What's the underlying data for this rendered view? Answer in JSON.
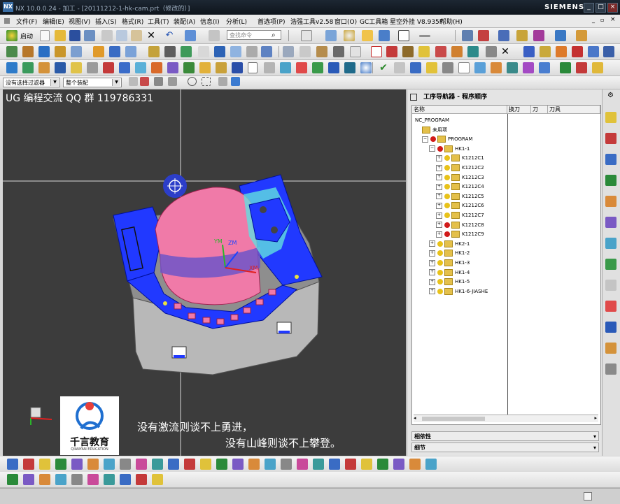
{
  "window": {
    "title": "NX 10.0.0.24 - 加工 - [20111212-1-hk-cam.prt（修改的）]",
    "brand": "SIEMENS",
    "app_icon": "NX"
  },
  "menu": {
    "items": [
      "文件(F)",
      "编辑(E)",
      "视图(V)",
      "插入(S)",
      "格式(R)",
      "工具(T)",
      "装配(A)",
      "信息(I)",
      "分析(L)",
      "首选项(P)",
      "浩强工具v2.58",
      "窗口(O)",
      "GC工具箱",
      "星空外挂 V8.935F",
      "帮助(H)"
    ]
  },
  "toolbar": {
    "start_label": "启动",
    "search_placeholder": "查找命令",
    "filter_value": "没有选择过滤器",
    "assembly_value": "整个装配"
  },
  "viewport": {
    "watermark_title": "UG 编程交流 QQ 群 119786331",
    "axis_labels": {
      "ym": "YM",
      "zm": "ZM",
      "xm": "XM"
    },
    "logo_text": "千言教育",
    "logo_subtext": "QIANYAN EDUCATION",
    "caption_line1": "没有激流则谈不上勇进，",
    "caption_line2": "没有山峰则谈不上攀登。"
  },
  "navigator": {
    "title": "工序导航器 - 程序顺序",
    "columns": [
      "名称",
      "换刀",
      "刀",
      "刀具"
    ],
    "rows": [
      {
        "label": "NC_PROGRAM",
        "level": 0,
        "expander": "",
        "icon": "none"
      },
      {
        "label": "未用项",
        "level": 1,
        "expander": "",
        "icon": "folder"
      },
      {
        "label": "PROGRAM",
        "level": 1,
        "expander": "−",
        "icon": "forbidden"
      },
      {
        "label": "HK1-1",
        "level": 2,
        "expander": "−",
        "icon": "forbidden"
      },
      {
        "label": "K1212C1",
        "level": 3,
        "expander": "+",
        "icon": "yellow"
      },
      {
        "label": "K1212C2",
        "level": 3,
        "expander": "+",
        "icon": "yellow"
      },
      {
        "label": "K1212C3",
        "level": 3,
        "expander": "+",
        "icon": "yellow"
      },
      {
        "label": "K1212C4",
        "level": 3,
        "expander": "+",
        "icon": "yellow"
      },
      {
        "label": "K1212C5",
        "level": 3,
        "expander": "+",
        "icon": "yellow"
      },
      {
        "label": "K1212C6",
        "level": 3,
        "expander": "+",
        "icon": "yellow"
      },
      {
        "label": "K1212C7",
        "level": 3,
        "expander": "+",
        "icon": "yellow"
      },
      {
        "label": "K1212C8",
        "level": 3,
        "expander": "+",
        "icon": "forbidden"
      },
      {
        "label": "K1212C9",
        "level": 3,
        "expander": "+",
        "icon": "forbidden"
      },
      {
        "label": "HK2-1",
        "level": 2,
        "expander": "+",
        "icon": "yellow"
      },
      {
        "label": "HK1-2",
        "level": 2,
        "expander": "+",
        "icon": "yellow"
      },
      {
        "label": "HK1-3",
        "level": 2,
        "expander": "+",
        "icon": "yellow"
      },
      {
        "label": "HK1-4",
        "level": 2,
        "expander": "+",
        "icon": "yellow"
      },
      {
        "label": "HK1-5",
        "level": 2,
        "expander": "+",
        "icon": "yellow"
      },
      {
        "label": "HK1-6-JIASHE",
        "level": 2,
        "expander": "+",
        "icon": "yellow"
      }
    ],
    "section_dependencies": "相依性",
    "section_details": "细节"
  },
  "colors": {
    "viewport_bg": "#3c3c3c",
    "part_blue": "#1e3cff",
    "part_pink": "#f07aa8",
    "part_gray": "#b5b5b5",
    "forbidden": "#d11a1a",
    "pending": "#e8c21a"
  },
  "icons": {
    "resource_bar": [
      "operation-navigator-icon",
      "machine-tool-navigator-icon",
      "geometry-navigator-icon",
      "method-navigator-icon",
      "assembly-navigator-icon",
      "constraint-navigator-icon",
      "part-navigator-icon",
      "reuse-library-icon",
      "history-icon",
      "process-studio-icon",
      "roles-icon",
      "palette-icon",
      "system-materials-icon"
    ]
  }
}
